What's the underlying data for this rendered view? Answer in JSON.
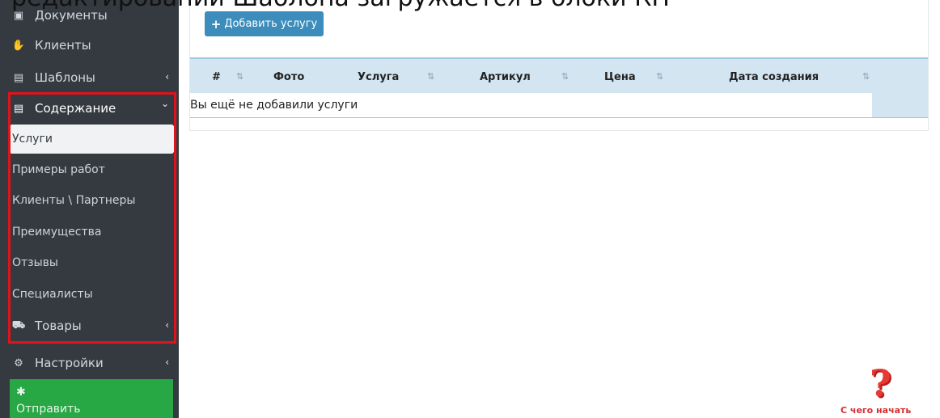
{
  "caption": "редактировании Шаблона загружается в блоки КП",
  "sidebar": {
    "items": [
      {
        "label": "Документы",
        "icon": "document-icon",
        "top": 0
      },
      {
        "label": "Клиенты",
        "icon": "handshake-icon"
      },
      {
        "label": "Шаблоны",
        "icon": "file-icon",
        "chevron": "‹"
      },
      {
        "label": "Содержание",
        "icon": "file-icon",
        "chevron": "⌄"
      }
    ],
    "content_submenu": [
      "Услуги",
      "Примеры работ",
      "Клиенты \\ Партнеры",
      "Преимущества",
      "Отзывы",
      "Специалисты"
    ],
    "goods": {
      "label": "Товары",
      "icon": "goods-icon",
      "chevron": "‹"
    },
    "settings": {
      "label": "Настройки",
      "icon": "gears-icon",
      "chevron": "‹"
    },
    "send": {
      "label": "Отправить",
      "icon": "bug-icon"
    }
  },
  "toolbar": {
    "add_label": "Добавить услугу",
    "add_icon": "+"
  },
  "table": {
    "columns": [
      "#",
      "Фото",
      "Услуга",
      "Артикул",
      "Цена",
      "Дата создания"
    ],
    "sort_icon": "⇅",
    "empty_text": "Вы ещё не добавили услуги"
  },
  "help": {
    "symbol": "?",
    "label": "С чего начать"
  },
  "colors": {
    "sidebar_bg": "#343a40",
    "accent_blue": "#3c8dbc",
    "send_green": "#28a745",
    "highlight_red": "#e0131a",
    "table_head": "#d2e5f1"
  }
}
